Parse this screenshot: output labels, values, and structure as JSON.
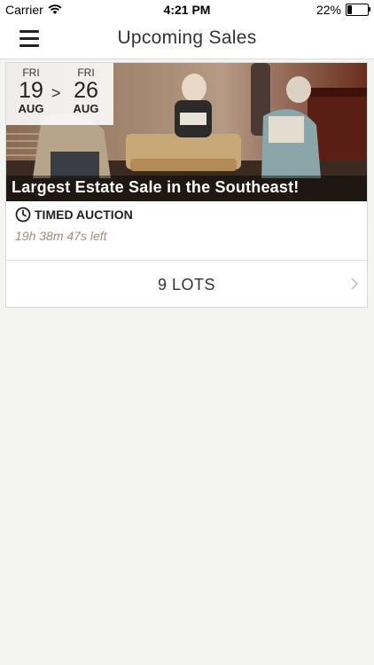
{
  "status": {
    "carrier": "Carrier",
    "time": "4:21 PM",
    "battery": "22%"
  },
  "nav": {
    "title": "Upcoming Sales"
  },
  "sale": {
    "start": {
      "dow": "FRI",
      "day": "19",
      "month": "AUG"
    },
    "separator": ">",
    "end": {
      "dow": "FRI",
      "day": "26",
      "month": "AUG"
    },
    "title": "Largest Estate Sale in the Southeast!",
    "auction_type": "TIMED AUCTION",
    "time_left": "19h 38m 47s left",
    "lots_label": "9 LOTS"
  },
  "icons": {
    "menu": "hamburger-icon",
    "clock": "clock-icon",
    "chevron": "chevron-right-icon",
    "wifi": "wifi-icon",
    "battery": "battery-icon"
  },
  "colors": {
    "background": "#f4f4f0",
    "countdown": "#9a8f7c",
    "title_overlay": "rgba(0,0,0,0.45)"
  }
}
